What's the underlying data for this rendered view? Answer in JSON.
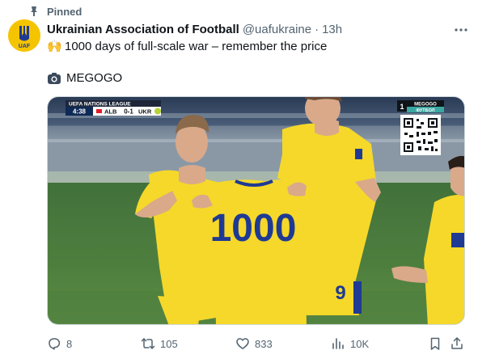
{
  "pinned": {
    "label": "Pinned",
    "icon": "pin-icon"
  },
  "author": {
    "name": "Ukrainian Association of Football",
    "handle": "@uafukraine",
    "separator": "·",
    "time": "13h",
    "avatar_text": "UAF"
  },
  "tweet": {
    "emoji": "🙌",
    "text": "1000 days of full-scale war – remember the price",
    "source_emoji_icon": "camera-icon",
    "source": "MEGOGO"
  },
  "media": {
    "scorebug": {
      "competition": "UEFA NATIONS LEAGUE",
      "clock": "4:38",
      "home": "ALB",
      "score": "0-1",
      "away": "UKR"
    },
    "broadcaster": {
      "channel_number": "1",
      "brand": "MEGOGO",
      "subtitle": "ФУТБОЛ"
    },
    "shirt_number": "1000",
    "player_number": "9"
  },
  "actions": {
    "replies": "8",
    "reposts": "105",
    "likes": "833",
    "views": "10K"
  },
  "colors": {
    "text_primary": "#0f1419",
    "text_secondary": "#536471",
    "ukraine_yellow": "#f5d82a",
    "ukraine_blue": "#1f3a93"
  }
}
